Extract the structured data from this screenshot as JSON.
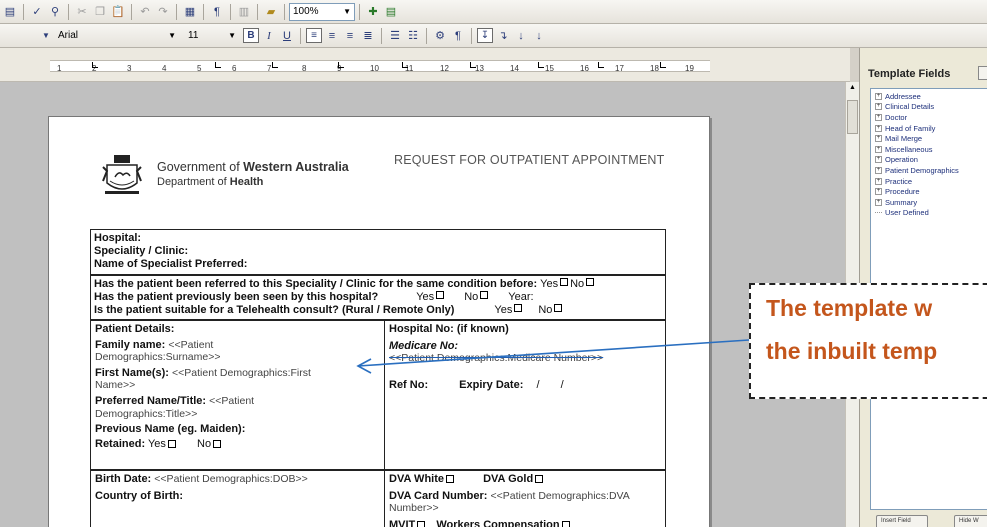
{
  "toolbar": {
    "zoom": "100%",
    "font": "Arial",
    "size": "11",
    "bold": "B",
    "italic": "I",
    "underline": "U"
  },
  "ruler": {
    "ticks": [
      "1",
      "2",
      "3",
      "4",
      "5",
      "6",
      "7",
      "8",
      "9",
      "10",
      "11",
      "12",
      "13",
      "14",
      "15",
      "16",
      "17",
      "18",
      "19"
    ]
  },
  "panel": {
    "title": "Template Fields",
    "items": [
      "Addressee",
      "Clinical Details",
      "Doctor",
      "Head of Family",
      "Mail Merge",
      "Miscellaneous",
      "Operation",
      "Patient Demographics",
      "Practice",
      "Procedure",
      "Summary",
      "User Defined"
    ],
    "btn1": "Insert Field",
    "btn2": "Hide W"
  },
  "form": {
    "gov_prefix": "Government of ",
    "gov_bold": "Western Australia",
    "dept_prefix": "Department of ",
    "dept_bold": "Health",
    "title": "REQUEST FOR OUTPATIENT APPOINTMENT",
    "hospital": "Hospital:",
    "speciality": "Speciality / Clinic:",
    "specialist": "Name of Specialist Preferred:",
    "q1": "Has the patient been referred to this Speciality / Clinic for the same condition before:",
    "q2": "Has the patient previously been seen by this hospital?",
    "q3": "Is the patient suitable for a Telehealth consult? (Rural / Remote Only)",
    "yes": "Yes",
    "no": "No",
    "year": "Year:",
    "patient_details": "Patient Details:",
    "family_name_label": "Family name:",
    "family_name_val_1": "<<Patient",
    "family_name_val_2": "Demographics:Surname>>",
    "first_name_label": "First Name(s):",
    "first_name_val_1": "<<Patient Demographics:First",
    "first_name_val_2": "Name>>",
    "pref_name_label": "Preferred Name/Title:",
    "pref_name_val_1": "<<Patient",
    "pref_name_val_2": "Demographics:Title>>",
    "prev_name": "Previous Name (eg. Maiden):",
    "retained": "Retained:",
    "hospital_no": "Hospital No: (if known)",
    "medicare_no": "Medicare No:",
    "medicare_val": "<<Patient Demographics:Medicare Number>>",
    "ref_no": "Ref No:",
    "expiry": "Expiry Date:",
    "expiry_sep1": "/",
    "expiry_sep2": "/",
    "birth_date_label": "Birth Date:",
    "birth_date_val": "<<Patient Demographics:DOB>>",
    "country": "Country of Birth:",
    "dva_white": "DVA White",
    "dva_gold": "DVA Gold",
    "dva_card_label": "DVA Card Number:",
    "dva_card_val_1": "<<Patient Demographics:DVA",
    "dva_card_val_2": "Number>>",
    "mvit": "MVIT",
    "workers_comp": "Workers Compensation"
  },
  "callout": {
    "line1": "The template w",
    "line2": "the inbuilt temp",
    "color": "#c4561c"
  }
}
